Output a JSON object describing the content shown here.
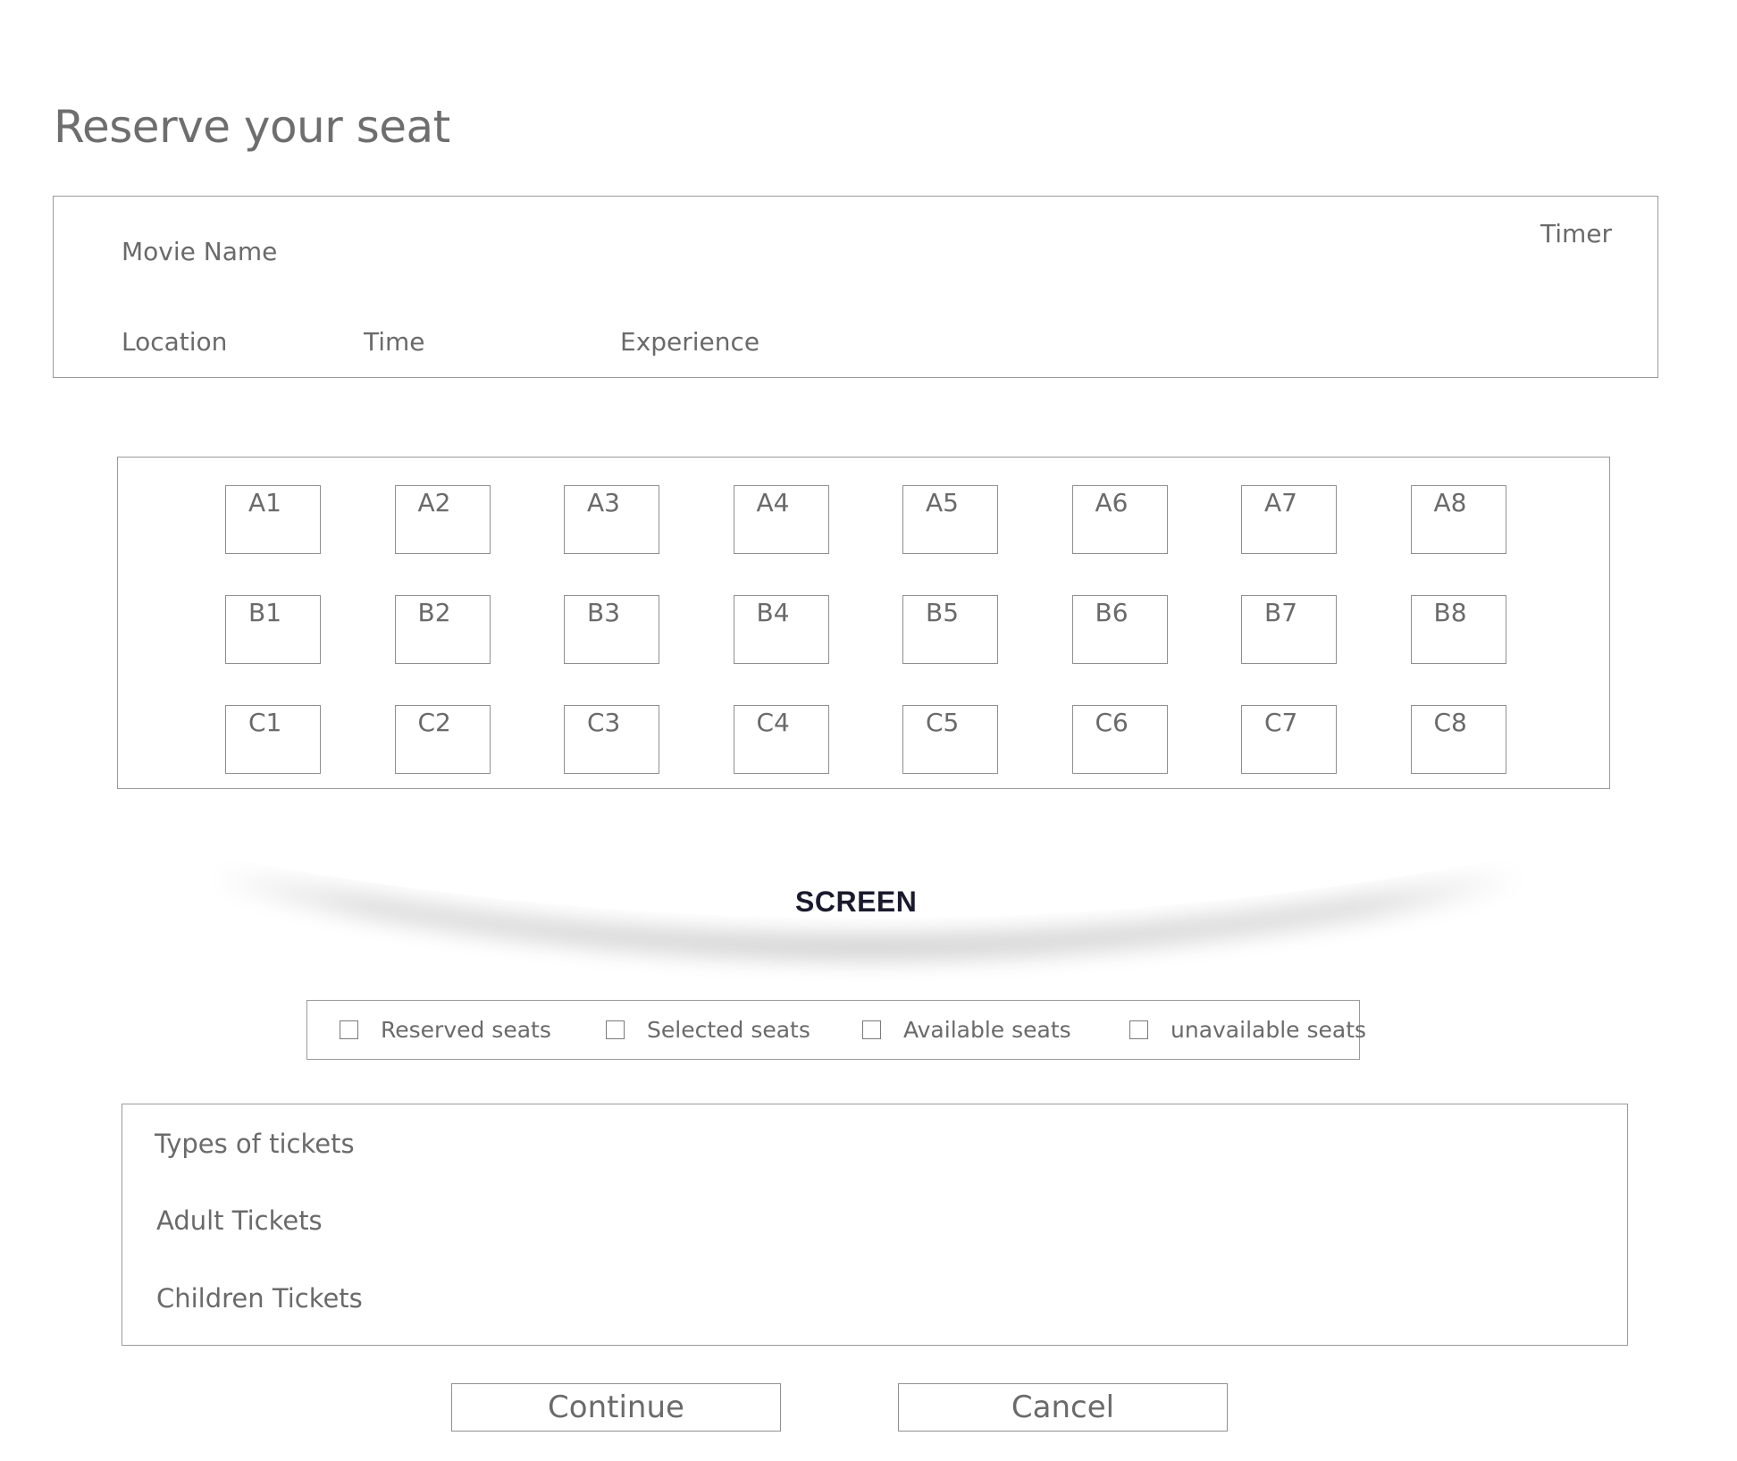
{
  "page": {
    "title": "Reserve your seat"
  },
  "info": {
    "movie_name": "Movie Name",
    "timer": "Timer",
    "location": "Location",
    "time": "Time",
    "experience": "Experience"
  },
  "seats": {
    "rows": [
      [
        "A1",
        "A2",
        "A3",
        "A4",
        "A5",
        "A6",
        "A7",
        "A8"
      ],
      [
        "B1",
        "B2",
        "B3",
        "B4",
        "B5",
        "B6",
        "B7",
        "B8"
      ],
      [
        "C1",
        "C2",
        "C3",
        "C4",
        "C5",
        "C6",
        "C7",
        "C8"
      ]
    ]
  },
  "screen": {
    "label": "SCREEN"
  },
  "legend": {
    "items": [
      "Reserved seats",
      "Selected seats",
      "Available seats",
      "unavailable seats"
    ]
  },
  "tickets": {
    "heading": "Types of tickets",
    "adult": "Adult Tickets",
    "children": "Children Tickets"
  },
  "actions": {
    "continue_label": "Continue",
    "cancel_label": "Cancel"
  },
  "colors": {
    "border": "#9a9a9a",
    "text": "#6a6a6a",
    "screen_text": "#1a1a2e"
  }
}
